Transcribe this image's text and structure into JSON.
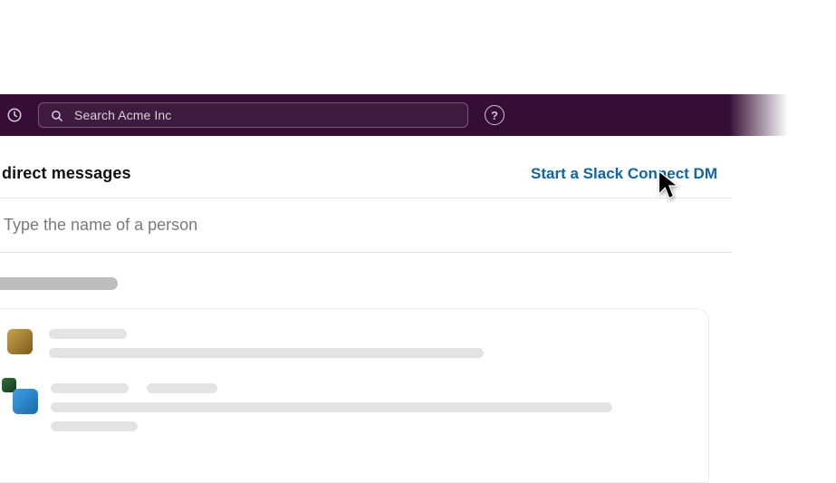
{
  "topbar": {
    "search_placeholder": "Search Acme Inc",
    "help_symbol": "?"
  },
  "header": {
    "title": "direct messages",
    "connect_link": "Start a Slack Connect DM"
  },
  "compose": {
    "name_placeholder": "Type the name of a person"
  }
}
